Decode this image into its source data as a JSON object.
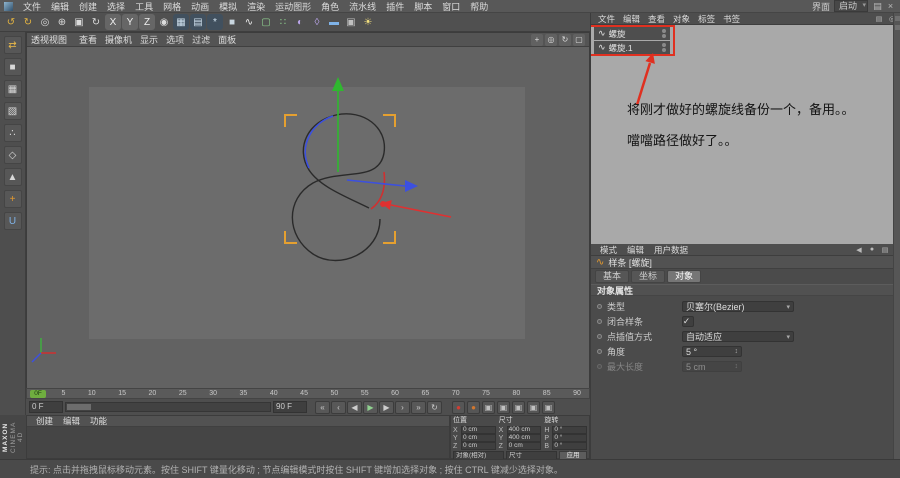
{
  "colors": {
    "accent_orange": "#e59a2f",
    "annotation_red": "#e03020",
    "playhead_green": "#6fae3f"
  },
  "window": {
    "interface_label": "界面",
    "interface_value": "启动",
    "buttons": [
      {
        "name": "window-menu-button",
        "glyph": "▤"
      },
      {
        "name": "window-close-button",
        "glyph": "×"
      }
    ]
  },
  "menu_bar": {
    "items": [
      "文件",
      "编辑",
      "创建",
      "选择",
      "工具",
      "网格",
      "动画",
      "模拟",
      "渲染",
      "运动图形",
      "角色",
      "流水线",
      "插件",
      "脚本",
      "窗口",
      "帮助"
    ]
  },
  "toolbar": {
    "icons": [
      {
        "name": "undo-button",
        "glyph": "↺",
        "fg": "#e3b341"
      },
      {
        "name": "redo-button",
        "glyph": "↻",
        "fg": "#e3b341"
      },
      {
        "name": "live-selection-button",
        "glyph": "◎",
        "fg": "#dcdcdc"
      },
      {
        "name": "move-tool-button",
        "glyph": "⊕",
        "fg": "#dcdcdc"
      },
      {
        "name": "scale-tool-button",
        "glyph": "▣",
        "fg": "#dcdcdc"
      },
      {
        "name": "rotate-tool-button",
        "glyph": "↻",
        "fg": "#dcdcdc"
      },
      {
        "name": "lock-x-axis-button",
        "glyph": "X",
        "bg": "#666666",
        "fg": "#efefef"
      },
      {
        "name": "lock-y-axis-button",
        "glyph": "Y",
        "bg": "#666666",
        "fg": "#efefef"
      },
      {
        "name": "lock-z-axis-button",
        "glyph": "Z",
        "bg": "#666666",
        "fg": "#efefef"
      },
      {
        "name": "coordinate-system-button",
        "glyph": "◉",
        "fg": "#dcdcdc"
      },
      {
        "name": "render-view-button",
        "glyph": "▦",
        "bg": "#41505e",
        "fg": "#cfe0ee"
      },
      {
        "name": "render-picture-viewer-button",
        "glyph": "▤",
        "bg": "#41505e",
        "fg": "#cfe0ee"
      },
      {
        "name": "render-settings-button",
        "glyph": "*",
        "bg": "#41505e",
        "fg": "#cfe0ee"
      },
      {
        "name": "add-cube-button",
        "glyph": "■",
        "fg": "#c9d6df"
      },
      {
        "name": "spline-pen-button",
        "glyph": "∿",
        "fg": "#ececec"
      },
      {
        "name": "subdivision-surface-button",
        "glyph": "▢",
        "fg": "#8fd08f"
      },
      {
        "name": "generators-button",
        "glyph": "∷",
        "fg": "#8fd08f"
      },
      {
        "name": "modeling-button",
        "glyph": "◐",
        "fg": "#b9a4e8"
      },
      {
        "name": "deformers-button",
        "glyph": "◊",
        "fg": "#b9a4e8"
      },
      {
        "name": "environment-button",
        "glyph": "▬",
        "fg": "#7fb3e8"
      },
      {
        "name": "camera-button",
        "glyph": "▣",
        "fg": "#c0c0c0"
      },
      {
        "name": "light-button",
        "glyph": "☀",
        "fg": "#f2df7e"
      }
    ]
  },
  "palette": {
    "icons": [
      {
        "name": "make-editable-button",
        "glyph": "⇄",
        "fg": "#e8b84a"
      },
      {
        "name": "model-mode-button",
        "glyph": "■",
        "fg": "#d8d8d8"
      },
      {
        "name": "texture-mode-button",
        "glyph": "▦",
        "fg": "#d8d8d8"
      },
      {
        "name": "workplane-mode-button",
        "glyph": "▧",
        "fg": "#d8d8d8"
      },
      {
        "name": "points-mode-button",
        "glyph": "∴",
        "fg": "#d8d8d8"
      },
      {
        "name": "edges-mode-button",
        "glyph": "◇",
        "fg": "#d8d8d8"
      },
      {
        "name": "polygons-mode-button",
        "glyph": "▲",
        "fg": "#d8d8d8"
      },
      {
        "name": "enable-axis-button",
        "glyph": "+",
        "fg": "#e59a2f"
      },
      {
        "name": "snap-settings-button",
        "glyph": "U",
        "fg": "#7fb3e8"
      }
    ]
  },
  "viewport": {
    "title": "透视视图",
    "menus": [
      "查看",
      "摄像机",
      "显示",
      "选项",
      "过滤",
      "面板"
    ],
    "nav_icons": [
      {
        "name": "pan-view-button",
        "glyph": "+"
      },
      {
        "name": "zoom-view-button",
        "glyph": "◎"
      },
      {
        "name": "rotate-view-button",
        "glyph": "↻"
      },
      {
        "name": "toggle-view-button",
        "glyph": "▢"
      }
    ]
  },
  "timeline": {
    "playhead": "0F",
    "ticks": [
      "0",
      "5",
      "10",
      "15",
      "20",
      "25",
      "30",
      "35",
      "40",
      "45",
      "50",
      "55",
      "60",
      "65",
      "70",
      "75",
      "80",
      "85",
      "90"
    ]
  },
  "transport": {
    "current_frame": "0 F",
    "end_frame": "90 F",
    "buttons": [
      {
        "name": "goto-start-button",
        "glyph": "«"
      },
      {
        "name": "prev-key-button",
        "glyph": "‹"
      },
      {
        "name": "prev-frame-button",
        "glyph": "◀"
      },
      {
        "name": "play-button",
        "glyph": "▶",
        "fg": "#8fd08f"
      },
      {
        "name": "next-frame-button",
        "glyph": "▶"
      },
      {
        "name": "next-key-button",
        "glyph": "›"
      },
      {
        "name": "goto-end-button",
        "glyph": "»"
      },
      {
        "name": "loop-button",
        "glyph": "↻"
      }
    ],
    "record_buttons": [
      {
        "name": "record-keyframe-button",
        "glyph": "●",
        "fg": "#d23d32"
      },
      {
        "name": "autokey-toggle",
        "glyph": "●",
        "fg": "#d2772f"
      },
      {
        "name": "record-position-toggle",
        "glyph": "▣",
        "fg": "#c0c0c0"
      },
      {
        "name": "record-scale-toggle",
        "glyph": "▣",
        "fg": "#c0c0c0"
      },
      {
        "name": "record-rotation-toggle",
        "glyph": "▣",
        "fg": "#c0c0c0"
      },
      {
        "name": "record-parameter-toggle",
        "glyph": "▣",
        "fg": "#c0c0c0"
      },
      {
        "name": "record-pla-toggle",
        "glyph": "▣",
        "fg": "#c0c0c0"
      }
    ]
  },
  "material_manager": {
    "menus": [
      "创建",
      "编辑",
      "功能"
    ]
  },
  "coordinates": {
    "position_title": "位置",
    "size_title": "尺寸",
    "rotation_title": "旋转",
    "position_rows": [
      {
        "axis": "X",
        "value": "0 cm"
      },
      {
        "axis": "Y",
        "value": "0 cm"
      },
      {
        "axis": "Z",
        "value": "0 cm"
      }
    ],
    "size_rows": [
      {
        "axis": "X",
        "value": "400 cm"
      },
      {
        "axis": "Y",
        "value": "400 cm"
      },
      {
        "axis": "Z",
        "value": "0 cm"
      }
    ],
    "rotation_rows": [
      {
        "axis": "H",
        "value": "0 °"
      },
      {
        "axis": "P",
        "value": "0 °"
      },
      {
        "axis": "B",
        "value": "0 °"
      }
    ],
    "mode_dropdown": "对象(相对)",
    "size_dropdown": "尺寸",
    "apply_button": "应用"
  },
  "object_manager": {
    "menus": [
      "文件",
      "编辑",
      "查看",
      "对象",
      "标签",
      "书签"
    ],
    "bar_icons": [
      {
        "name": "om-filter-button",
        "glyph": "▤"
      },
      {
        "name": "om-search-button",
        "glyph": "◎"
      }
    ],
    "objects": [
      {
        "name": "螺旋",
        "icon": "∿"
      },
      {
        "name": "螺旋.1",
        "icon": "∿"
      }
    ]
  },
  "annotation": {
    "line1": "将刚才做好的螺旋线备份一个，备用。。",
    "line2": "噹噹路径做好了。。"
  },
  "attributes": {
    "menus": [
      "模式",
      "编辑",
      "用户数据"
    ],
    "bar_icons": [
      {
        "name": "attr-history-back-button",
        "glyph": "◀"
      },
      {
        "name": "attr-lock-button",
        "glyph": "●"
      },
      {
        "name": "attr-panel-menu-button",
        "glyph": "▤"
      }
    ],
    "title_icon": "∿",
    "title": "样条 [螺旋]",
    "tabs": [
      {
        "label": "基本",
        "active": "false"
      },
      {
        "label": "坐标",
        "active": "false"
      },
      {
        "label": "对象",
        "active": "true"
      }
    ],
    "section": "对象属性",
    "rows": [
      {
        "label": "类型",
        "value": "贝塞尔(Bezier)",
        "suffix": "▾",
        "control": "dropdown"
      },
      {
        "label": "闭合样条",
        "value": "✓",
        "suffix": "",
        "control": "check"
      },
      {
        "label": "点插值方式",
        "value": "自动适应",
        "suffix": "▾",
        "control": "dropdown"
      },
      {
        "label": "角度",
        "value": "5 °",
        "suffix": "↕",
        "control": "number"
      },
      {
        "label": "最大长度",
        "value": "5 cm",
        "suffix": "↕",
        "control": "number",
        "disabled": "true"
      }
    ]
  },
  "logo": {
    "line1": "MAXON",
    "line2": "CINEMA 4D"
  },
  "status_bar": {
    "text": "提示: 点击并拖拽鼠标移动元素。按住 SHIFT 键量化移动 ; 节点编辑模式时按住 SHIFT 键增加选择对象 ; 按住 CTRL 键减少选择对象。"
  }
}
